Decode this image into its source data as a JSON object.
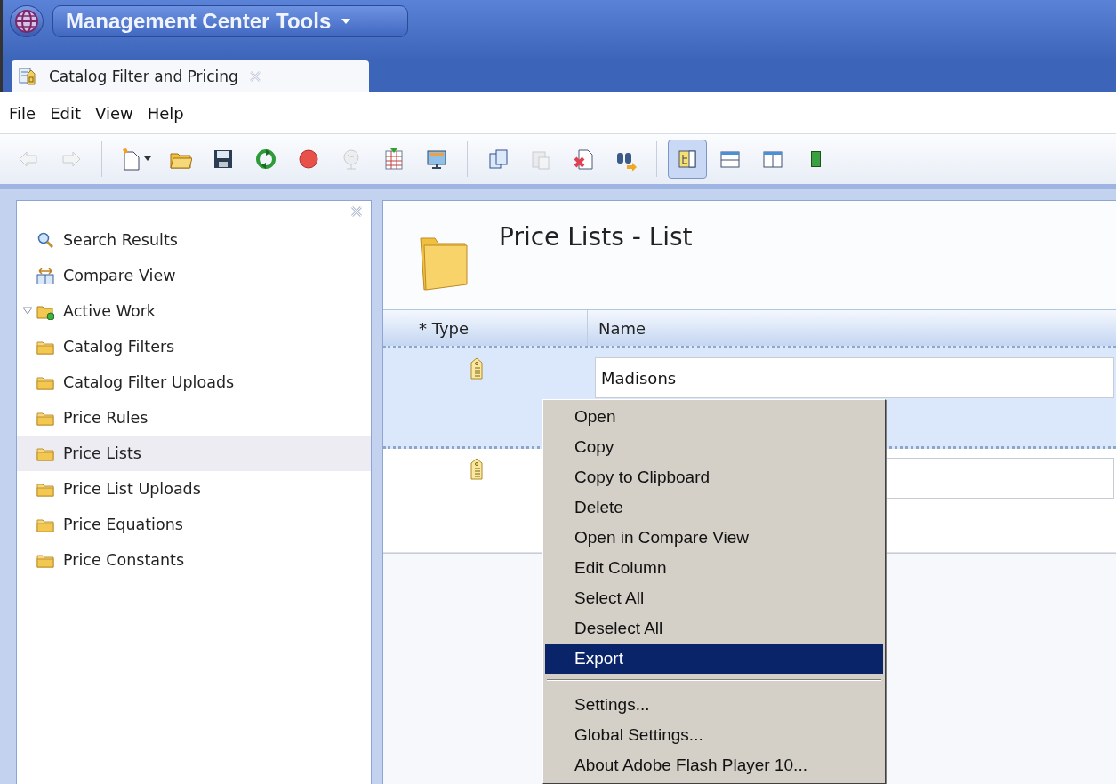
{
  "app_bar": {
    "title": "Management Center Tools"
  },
  "tabs": [
    {
      "label": "Catalog Filter and Pricing",
      "selected": true
    }
  ],
  "menu_bar": [
    "File",
    "Edit",
    "View",
    "Help"
  ],
  "toolbar": [
    {
      "kind": "back",
      "disabled": true,
      "selected": false
    },
    {
      "kind": "forward",
      "disabled": true,
      "selected": false
    },
    {
      "kind": "sep"
    },
    {
      "kind": "new",
      "disabled": false,
      "selected": false
    },
    {
      "kind": "open",
      "disabled": false,
      "selected": false
    },
    {
      "kind": "save",
      "disabled": false,
      "selected": false
    },
    {
      "kind": "refresh",
      "disabled": false,
      "selected": false
    },
    {
      "kind": "stop",
      "disabled": false,
      "selected": false
    },
    {
      "kind": "globe",
      "disabled": true,
      "selected": false
    },
    {
      "kind": "grid",
      "disabled": false,
      "selected": false
    },
    {
      "kind": "monitor",
      "disabled": false,
      "selected": false
    },
    {
      "kind": "sep"
    },
    {
      "kind": "copy",
      "disabled": false,
      "selected": false
    },
    {
      "kind": "paste",
      "disabled": true,
      "selected": false
    },
    {
      "kind": "delete",
      "disabled": false,
      "selected": false
    },
    {
      "kind": "find",
      "disabled": false,
      "selected": false
    },
    {
      "kind": "sep"
    },
    {
      "kind": "tree-layout",
      "disabled": false,
      "selected": true
    },
    {
      "kind": "rows-layout",
      "disabled": false,
      "selected": false
    },
    {
      "kind": "cols-layout",
      "disabled": false,
      "selected": false
    },
    {
      "kind": "partial",
      "disabled": false,
      "selected": false
    }
  ],
  "sidebar": {
    "items": [
      {
        "label": "Search Results",
        "kind": "search",
        "selected": false
      },
      {
        "label": "Compare View",
        "kind": "compare",
        "selected": false
      },
      {
        "label": "Active Work",
        "kind": "active",
        "selected": false,
        "expanded": true
      },
      {
        "label": "Catalog Filters",
        "kind": "folder",
        "selected": false
      },
      {
        "label": "Catalog Filter Uploads",
        "kind": "folder",
        "selected": false
      },
      {
        "label": "Price Rules",
        "kind": "folder",
        "selected": false
      },
      {
        "label": "Price Lists",
        "kind": "folder",
        "selected": true
      },
      {
        "label": "Price List Uploads",
        "kind": "folder",
        "selected": false
      },
      {
        "label": "Price Equations",
        "kind": "folder",
        "selected": false
      },
      {
        "label": "Price Constants",
        "kind": "folder",
        "selected": false
      }
    ]
  },
  "content": {
    "title": "Price Lists - List",
    "table": {
      "columns": [
        "* Type",
        "Name"
      ],
      "rows": [
        {
          "name": "Madisons",
          "selected": true
        },
        {
          "selected": false
        }
      ]
    }
  },
  "context_menu": {
    "items": [
      {
        "label": "Open",
        "selected": false,
        "separator_before": false
      },
      {
        "label": "Copy",
        "selected": false,
        "separator_before": false
      },
      {
        "label": "Copy to Clipboard",
        "selected": false,
        "separator_before": false
      },
      {
        "label": "Delete",
        "selected": false,
        "separator_before": false
      },
      {
        "label": "Open in Compare View",
        "selected": false,
        "separator_before": false
      },
      {
        "label": "Edit Column",
        "selected": false,
        "separator_before": false
      },
      {
        "label": "Select All",
        "selected": false,
        "separator_before": false
      },
      {
        "label": "Deselect All",
        "selected": false,
        "separator_before": false
      },
      {
        "label": "Export",
        "selected": true,
        "separator_before": false
      },
      {
        "label": "Settings...",
        "selected": false,
        "separator_before": true
      },
      {
        "label": "Global Settings...",
        "selected": false,
        "separator_before": false
      },
      {
        "label": "About Adobe Flash Player 10...",
        "selected": false,
        "separator_before": false
      }
    ]
  }
}
